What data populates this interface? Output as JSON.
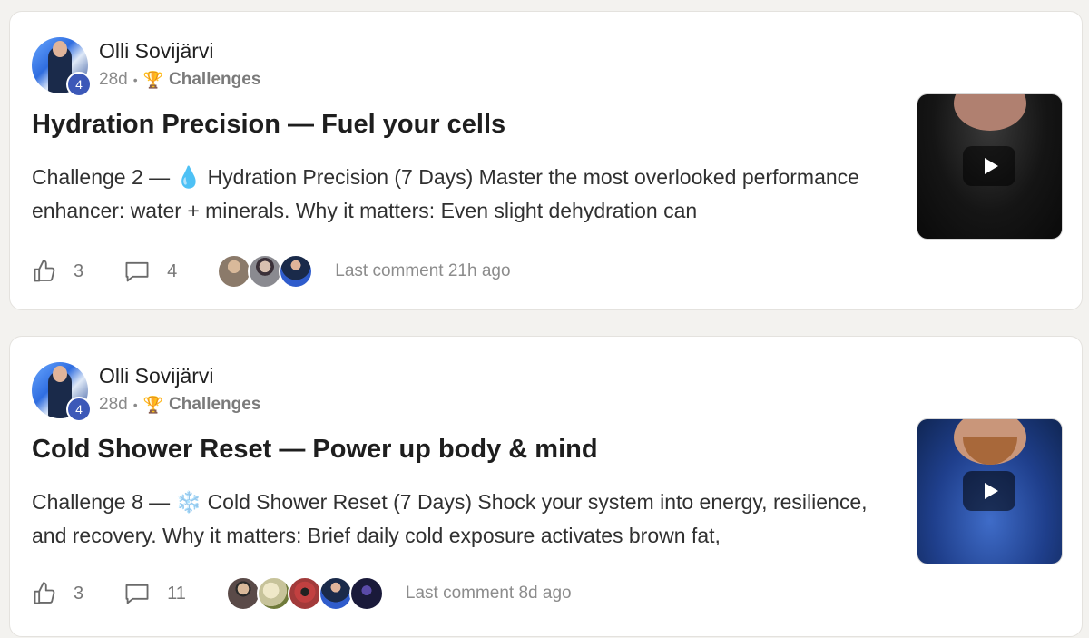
{
  "posts": [
    {
      "author": "Olli Sovijärvi",
      "level": "4",
      "age": "28d",
      "category_icon": "🏆",
      "category": "Challenges",
      "title": "Hydration Precision — Fuel your cells",
      "body": "Challenge 2 — 💧 Hydration Precision (7 Days) Master the most overlooked performance enhancer: water + minerals. Why it matters: Even slight dehydration can",
      "likes": "3",
      "comments": "4",
      "last_comment": "Last comment 21h ago",
      "commenter_colors": [
        "#8b7a6a",
        "#6f6e72",
        "#2f5ccc"
      ]
    },
    {
      "author": "Olli Sovijärvi",
      "level": "4",
      "age": "28d",
      "category_icon": "🏆",
      "category": "Challenges",
      "title": "Cold Shower Reset — Power up body & mind",
      "body": "Challenge 8 — ❄️ Cold Shower Reset (7 Days) Shock your system into energy, resilience, and recovery. Why it matters: Brief daily cold exposure activates brown fat,",
      "likes": "3",
      "comments": "11",
      "last_comment": "Last comment 8d ago",
      "commenter_colors": [
        "#5a4a48",
        "#c7c39a",
        "#a23a3a",
        "#2f5ccc",
        "#1a1a3a"
      ]
    }
  ],
  "icons": {
    "like": "thumbs-up-icon",
    "comment": "comment-bubble-icon",
    "play": "play-icon",
    "trophy": "trophy-icon"
  }
}
